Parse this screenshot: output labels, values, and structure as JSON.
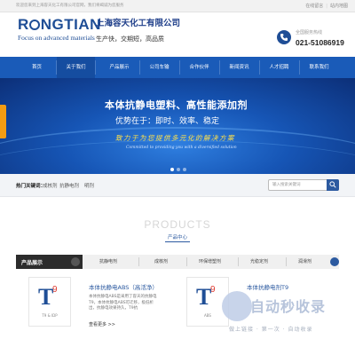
{
  "topbar": {
    "welcome": "欢迎您来到上海容天化工有限公司官网，我们将竭诚为您服务",
    "links": [
      "在线留言",
      "站内地图"
    ]
  },
  "header": {
    "logo_word_left": "R",
    "logo_word_right": "NGTIAN",
    "logo_tagline": "Focus on advanced materials",
    "company_name": "上海容天化工有限公司",
    "slogan": "生产快，交期短，高品质",
    "hotline_label": "全国服务热线",
    "hotline_number": "021-51086919"
  },
  "nav": {
    "items": [
      {
        "label": "首页"
      },
      {
        "label": "关于我们"
      },
      {
        "label": "产品展示"
      },
      {
        "label": "公司车输"
      },
      {
        "label": "合作伙伴"
      },
      {
        "label": "新闻资讯"
      },
      {
        "label": "人才招聘"
      },
      {
        "label": "联系我们"
      }
    ],
    "active_index": 1
  },
  "banner": {
    "headline": "本体抗静电塑料、高性能添加剂",
    "subline": "优势在于：即时、效率、稳定",
    "script": "致力于为您提供多元化的解决方案",
    "script_en": "Committed to providing you with a diversified solution",
    "slide_count": 3,
    "active_slide": 0
  },
  "hotbar": {
    "label": "热门关键词：",
    "keywords": [
      "成核剂",
      "抗静电剂",
      "明剂"
    ],
    "search_placeholder": "输入搜索关键词"
  },
  "products": {
    "title_en": "PRODUCTS",
    "title_cn": "产品中心"
  },
  "categories": {
    "title": "产品展示",
    "items": [
      "抗静电剂",
      "成核剂",
      "环保增塑剂",
      "光稳定剂",
      "润滑剂"
    ]
  },
  "cards": [
    {
      "title": "本体抗静电ABS（高活净）",
      "desc": "本体抗静电ABS是采用了容天的抗静电T9，本体抗静电ABS可迁移，极低析出，抗静电效果持久，T9抗",
      "more": "查看更多 >>",
      "thumb_label": "T9 & IDP"
    },
    {
      "title": "本体抗静电剂T9",
      "desc": "",
      "more": "",
      "thumb_label": "ABS"
    }
  ],
  "watermark": {
    "text": "自动秒收录",
    "sub": "做上链接 · 第一次 · 自动收录"
  }
}
